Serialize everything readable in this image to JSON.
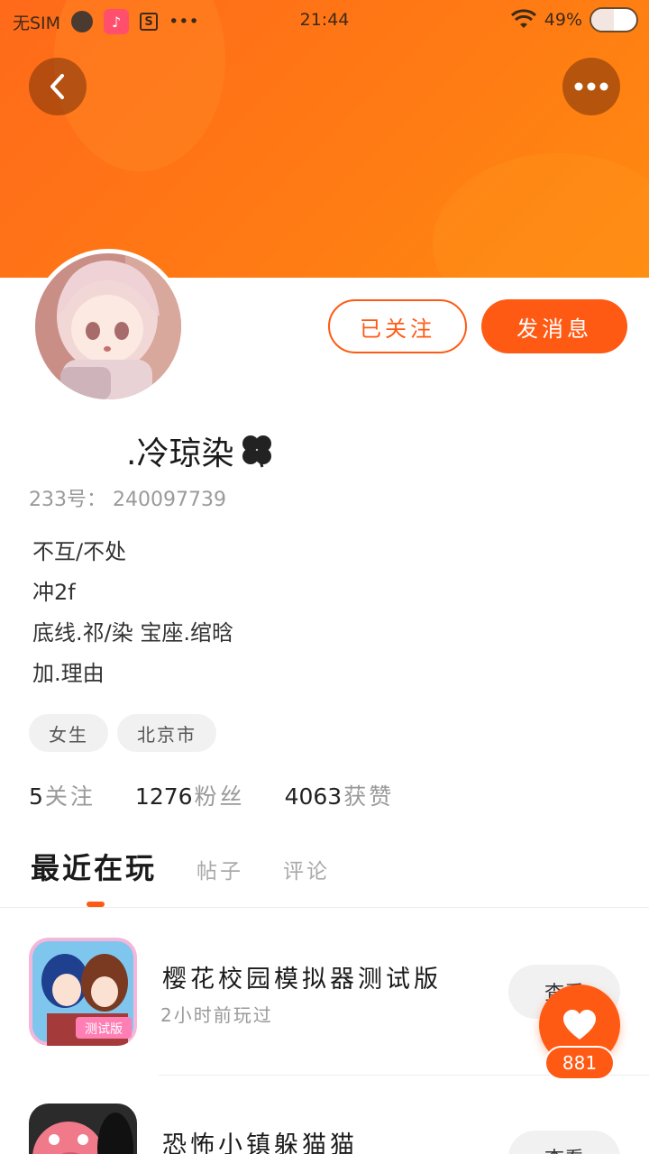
{
  "status_bar": {
    "carrier": "无SIM",
    "time": "21:44",
    "battery": "49%"
  },
  "profile": {
    "follow_button": "已关注",
    "message_button": "发消息",
    "nickname": ".冷琼染",
    "nickname_icon": "clover-icon",
    "uid_label": "233号：",
    "uid": "240097739",
    "bio": [
      "不互/不处",
      "冲2f",
      "底线.祁/染 宝座.绾晗",
      "加.理由"
    ],
    "tags": [
      "女生",
      "北京市"
    ],
    "stats": [
      {
        "num": "5",
        "label": "关注"
      },
      {
        "num": "1276",
        "label": "粉丝"
      },
      {
        "num": "4063",
        "label": "获赞"
      }
    ]
  },
  "tabs": [
    {
      "label": "最近在玩",
      "active": true
    },
    {
      "label": "帖子",
      "active": false
    },
    {
      "label": "评论",
      "active": false
    }
  ],
  "games": [
    {
      "title": "樱花校园模拟器测试版",
      "subtitle": "2小时前玩过",
      "button": "查看",
      "icon_badge": "测试版"
    },
    {
      "title": "恐怖小镇躲猫猫",
      "subtitle": "",
      "button": "查看"
    }
  ],
  "like": {
    "count": "881"
  },
  "colors": {
    "accent": "#ff5a14",
    "header": "#ff7a14"
  }
}
